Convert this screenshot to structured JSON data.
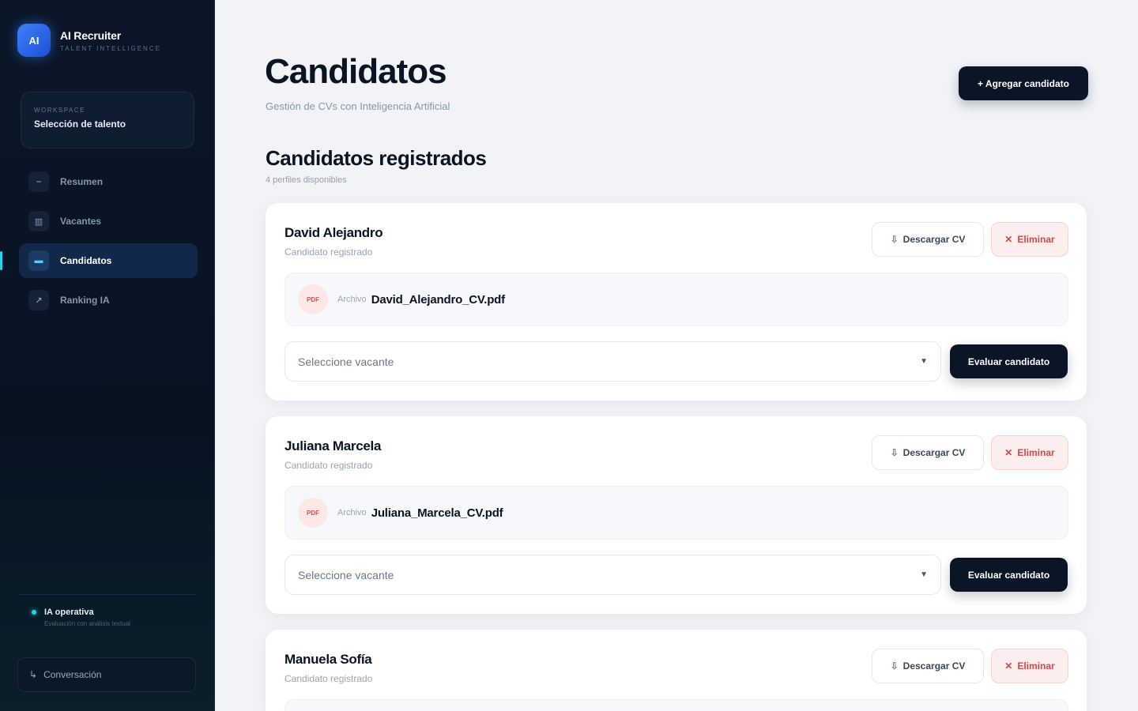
{
  "brand": {
    "logo": "AI",
    "name": "AI Recruiter",
    "subtitle": "TALENT INTELLIGENCE"
  },
  "workspace": {
    "label": "WORKSPACE",
    "name": "Selección de talento"
  },
  "nav": [
    {
      "label": "Resumen",
      "icon": "dash-icon"
    },
    {
      "label": "Vacantes",
      "icon": "columns-icon"
    },
    {
      "label": "Candidatos",
      "icon": "person-icon",
      "active": true
    },
    {
      "label": "Ranking IA",
      "icon": "chart-icon"
    }
  ],
  "status": {
    "title": "IA operativa",
    "subtitle": "Evaluación con análisis textual"
  },
  "conversation": {
    "label": "Conversación",
    "icon": "chat-icon"
  },
  "header": {
    "title": "Candidatos",
    "subtitle": "Gestión de CVs con Inteligencia Artificial",
    "add_button": "+ Agregar candidato"
  },
  "section": {
    "title": "Candidatos registrados",
    "subtitle": "4 perfiles disponibles"
  },
  "candidates": [
    {
      "name": "David Alejandro",
      "status": "Candidato registrado",
      "download_label": "Descargar CV",
      "delete_label": "Eliminar",
      "file_badge": "PDF",
      "file_label": "Archivo",
      "file_name": "David_Alejandro_CV.pdf",
      "vacancy_placeholder": "Seleccione vacante",
      "evaluate_label": "Evaluar candidato"
    },
    {
      "name": "Juliana Marcela",
      "status": "Candidato registrado",
      "download_label": "Descargar CV",
      "delete_label": "Eliminar",
      "file_badge": "PDF",
      "file_label": "Archivo",
      "file_name": "Juliana_Marcela_CV.pdf",
      "vacancy_placeholder": "Seleccione vacante",
      "evaluate_label": "Evaluar candidato"
    },
    {
      "name": "Manuela Sofía",
      "status": "Candidato registrado",
      "download_label": "Descargar CV",
      "delete_label": "Eliminar"
    }
  ],
  "colors": {
    "sidebar_bg": "#0a1628",
    "accent": "#22d3ee",
    "primary_button": "#0a1526",
    "danger": "#d04a4a",
    "page_bg": "#f1f3f7"
  }
}
